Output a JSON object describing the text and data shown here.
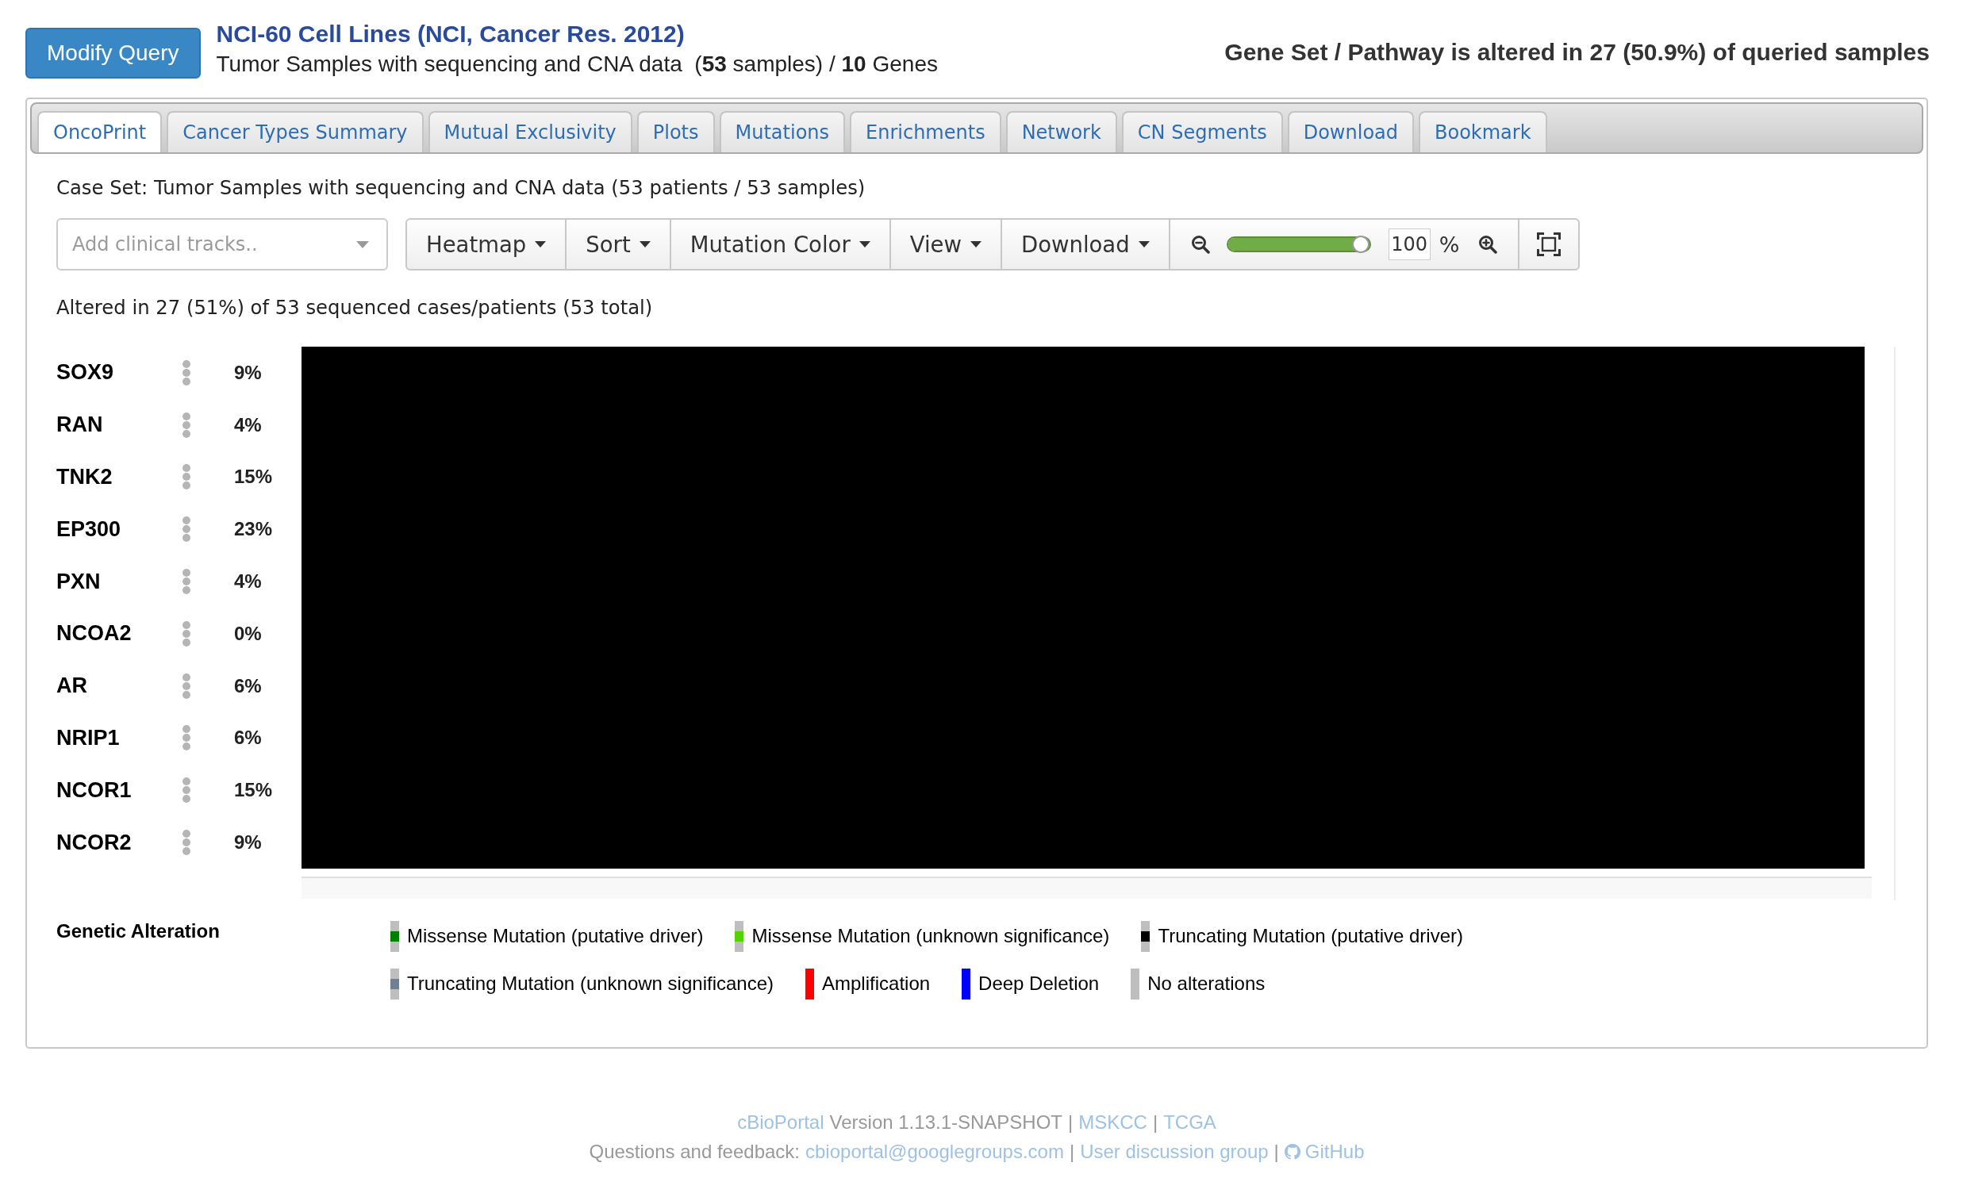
{
  "header": {
    "modify_button": "Modify Query",
    "study_title": "NCI-60 Cell Lines (NCI, Cancer Res. 2012)",
    "subtitle": "Tumor Samples with sequencing and CNA data  (**53** samples) / **10** Genes",
    "summary": "Gene Set / Pathway is altered in 27 (50.9%) of queried samples"
  },
  "tabs": [
    {
      "label": "OncoPrint",
      "selected": true
    },
    {
      "label": "Cancer Types Summary",
      "selected": false
    },
    {
      "label": "Mutual Exclusivity",
      "selected": false
    },
    {
      "label": "Plots",
      "selected": false
    },
    {
      "label": "Mutations",
      "selected": false
    },
    {
      "label": "Enrichments",
      "selected": false
    },
    {
      "label": "Network",
      "selected": false
    },
    {
      "label": "CN Segments",
      "selected": false
    },
    {
      "label": "Download",
      "selected": false
    },
    {
      "label": "Bookmark",
      "selected": false
    }
  ],
  "case_set": "Case Set: Tumor Samples with sequencing and CNA data (53 patients / 53 samples)",
  "toolbar": {
    "clinical_tracks": {
      "placeholder": "Add clinical tracks.."
    },
    "menus": [
      "Heatmap",
      "Sort",
      "Mutation Color",
      "View",
      "Download"
    ],
    "zoom": {
      "level": 1,
      "value": "100",
      "unit": "%"
    }
  },
  "altered_summary": "Altered in 27 (51%) of 53 sequenced cases/patients (53 total)",
  "oncoprint": {
    "tracks": [
      {
        "gene": "SOX9",
        "percent": "9%"
      },
      {
        "gene": "RAN",
        "percent": "4%"
      },
      {
        "gene": "TNK2",
        "percent": "15%"
      },
      {
        "gene": "EP300",
        "percent": "23%"
      },
      {
        "gene": "PXN",
        "percent": "4%"
      },
      {
        "gene": "NCOA2",
        "percent": "0%"
      },
      {
        "gene": "AR",
        "percent": "6%"
      },
      {
        "gene": "NRIP1",
        "percent": "6%"
      },
      {
        "gene": "NCOR1",
        "percent": "15%"
      },
      {
        "gene": "NCOR2",
        "percent": "9%"
      }
    ]
  },
  "legend": {
    "title": "Genetic Alteration",
    "items": [
      {
        "kind": "mutation",
        "label": "Missense Mutation (putative driver)",
        "color": "#008000"
      },
      {
        "kind": "mutation",
        "label": "Missense Mutation (unknown significance)",
        "color": "#53d400"
      },
      {
        "kind": "mutation",
        "label": "Truncating Mutation (putative driver)",
        "color": "#000000"
      },
      {
        "kind": "mutation",
        "label": "Truncating Mutation (unknown significance)",
        "color": "#708090"
      },
      {
        "kind": "bar",
        "label": "Amplification",
        "color": "#ff0000"
      },
      {
        "kind": "bar",
        "label": "Deep Deletion",
        "color": "#0000ff"
      },
      {
        "kind": "bar",
        "label": "No alterations",
        "color": "#bebebe"
      }
    ]
  },
  "footer": {
    "lines": [
      [
        {
          "kind": "link",
          "text": "cBioPortal"
        },
        {
          "kind": "text",
          "text": "Version 1.13.1-SNAPSHOT"
        },
        {
          "kind": "text",
          "text": "|"
        },
        {
          "kind": "link",
          "text": "MSKCC"
        },
        {
          "kind": "text",
          "text": "|"
        },
        {
          "kind": "link",
          "text": "TCGA"
        }
      ],
      [
        {
          "kind": "text",
          "text": "Questions and feedback:"
        },
        {
          "kind": "link",
          "text": "cbioportal@googlegroups.com"
        },
        {
          "kind": "text",
          "text": "|"
        },
        {
          "kind": "link",
          "text": "User discussion group"
        },
        {
          "kind": "text",
          "text": "|"
        },
        {
          "kind": "icon_link",
          "text": "GitHub"
        }
      ]
    ]
  }
}
